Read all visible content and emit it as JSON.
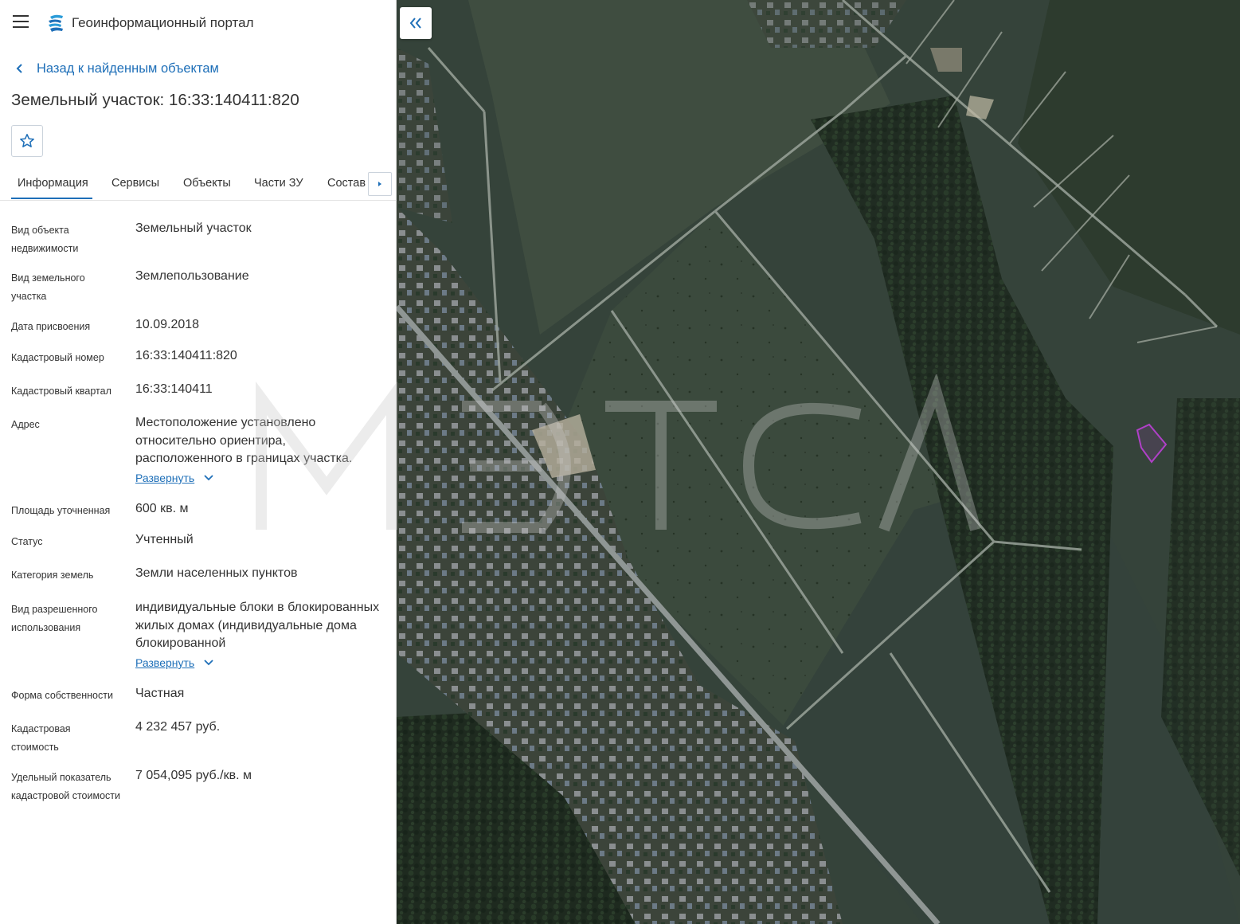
{
  "app": {
    "title": "Геоинформационный портал",
    "brand_color": "#1e6fb8"
  },
  "nav": {
    "back_label": "Назад к найденным объектам"
  },
  "object": {
    "title": "Земельный участок: 16:33:140411:820"
  },
  "tabs": [
    {
      "label": "Информация",
      "active": true
    },
    {
      "label": "Сервисы",
      "active": false
    },
    {
      "label": "Объекты",
      "active": false
    },
    {
      "label": "Части ЗУ",
      "active": false
    },
    {
      "label": "Состав",
      "active": false
    }
  ],
  "fields": [
    {
      "label": "Вид объекта недвижимости",
      "value": "Земельный участок"
    },
    {
      "label": "Вид земельного участка",
      "value": "Землепользование"
    },
    {
      "label": "Дата присвоения",
      "value": "10.09.2018"
    },
    {
      "label": "Кадастровый номер",
      "value": "16:33:140411:820"
    },
    {
      "label": "Кадастровый квартал",
      "value": "16:33:140411"
    },
    {
      "label": "Адрес",
      "value": "Местоположение установлено относительно ориентира, расположенного в границах участка.",
      "expand": "Развернуть"
    },
    {
      "label": "Площадь уточненная",
      "value": "600 кв. м"
    },
    {
      "label": "Статус",
      "value": "Учтенный"
    },
    {
      "label": "Категория земель",
      "value": "Земли населенных пунктов"
    },
    {
      "label": "Вид разрешенного использования",
      "value": "индивидуальные блоки в блокированных жилых домах (индивидуальные дома блокированной",
      "expand": "Развернуть"
    },
    {
      "label": "Форма собственности",
      "value": "Частная"
    },
    {
      "label": "Кадастровая стоимость",
      "value": "4 232 457 руб."
    },
    {
      "label": "Удельный показатель кадастровой стоимости",
      "value": "7 054,095 руб./кв. м"
    }
  ],
  "map": {
    "watermark": "МЭТСА",
    "parcel_color": "#b040c8"
  }
}
